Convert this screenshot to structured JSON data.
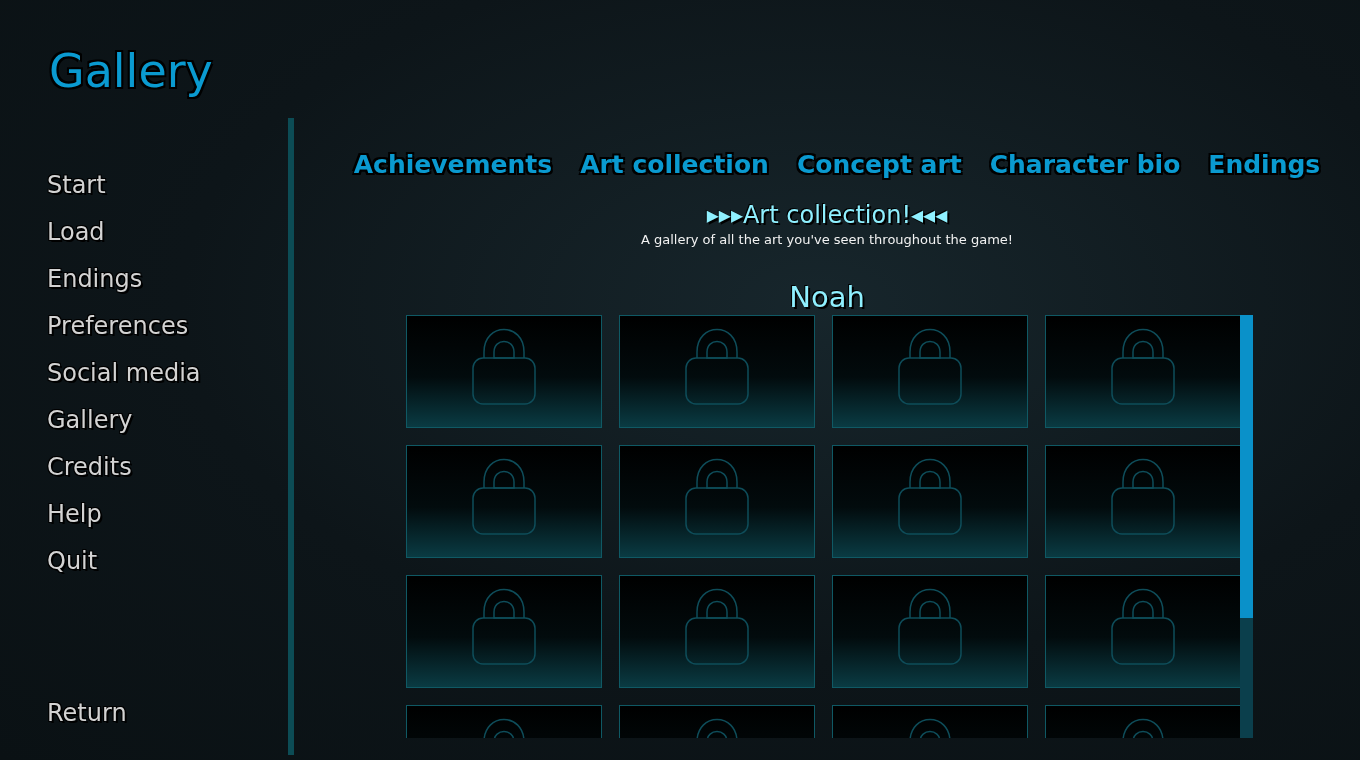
{
  "screen": {
    "title": "Gallery"
  },
  "menu": {
    "items": [
      {
        "label": "Start"
      },
      {
        "label": "Load"
      },
      {
        "label": "Endings"
      },
      {
        "label": "Preferences"
      },
      {
        "label": "Social media"
      },
      {
        "label": "Gallery"
      },
      {
        "label": "Credits"
      },
      {
        "label": "Help"
      },
      {
        "label": "Quit"
      }
    ],
    "return_label": "Return"
  },
  "tabs": [
    {
      "label": "Achievements"
    },
    {
      "label": "Art collection"
    },
    {
      "label": "Concept art"
    },
    {
      "label": "Character bio"
    },
    {
      "label": "Endings"
    }
  ],
  "heading": "▸▸▸Art collection!◂◂◂",
  "subtitle": "A gallery of all the art you've seen throughout the game!",
  "section": {
    "title": "Noah",
    "tiles": [
      {
        "locked": true
      },
      {
        "locked": true
      },
      {
        "locked": true
      },
      {
        "locked": true
      },
      {
        "locked": true
      },
      {
        "locked": true
      },
      {
        "locked": true
      },
      {
        "locked": true
      },
      {
        "locked": true
      },
      {
        "locked": true
      },
      {
        "locked": true
      },
      {
        "locked": true
      },
      {
        "locked": true
      },
      {
        "locked": true
      },
      {
        "locked": true
      },
      {
        "locked": true
      }
    ]
  }
}
